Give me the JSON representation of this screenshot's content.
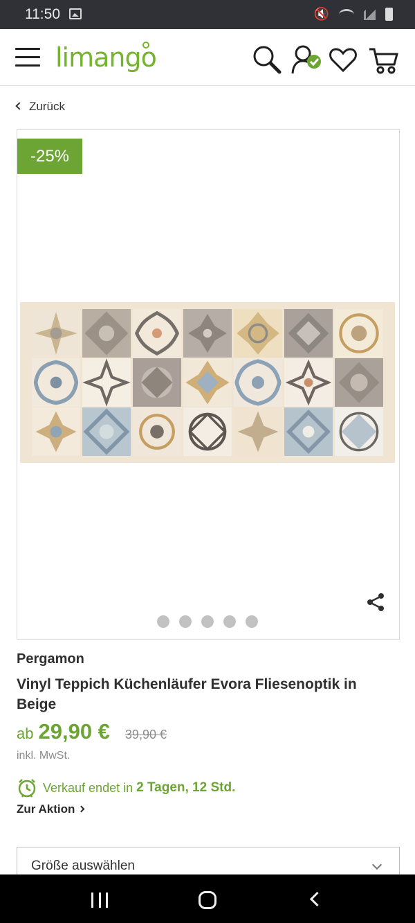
{
  "status_bar": {
    "time": "11:50",
    "icons": [
      "gallery-icon",
      "mute-icon",
      "wifi-icon",
      "signal-icon",
      "battery-icon"
    ]
  },
  "header": {
    "logo": "limango",
    "icons": [
      "menu-icon",
      "search-icon",
      "account-icon",
      "wishlist-icon",
      "cart-icon"
    ],
    "accent_color": "#6ca533"
  },
  "navigation": {
    "back_label": "Zurück"
  },
  "product": {
    "discount": "-25%",
    "gallery_dots": 5,
    "brand": "Pergamon",
    "title": "Vinyl Teppich Küchenläufer Evora Fliesenoptik in Beige",
    "price_prefix": "ab",
    "price": "29,90 €",
    "old_price": "39,90 €",
    "tax_note": "inkl. MwSt.",
    "sale": {
      "label": "Verkauf endet in",
      "remaining": "2 Tagen, 12 Std.",
      "icon": "alarm-clock-icon"
    },
    "action_link": "Zur Aktion",
    "size_select": {
      "placeholder": "Größe auswählen"
    }
  },
  "system_nav": {
    "icons": [
      "recent-apps-icon",
      "home-icon",
      "back-icon"
    ]
  }
}
